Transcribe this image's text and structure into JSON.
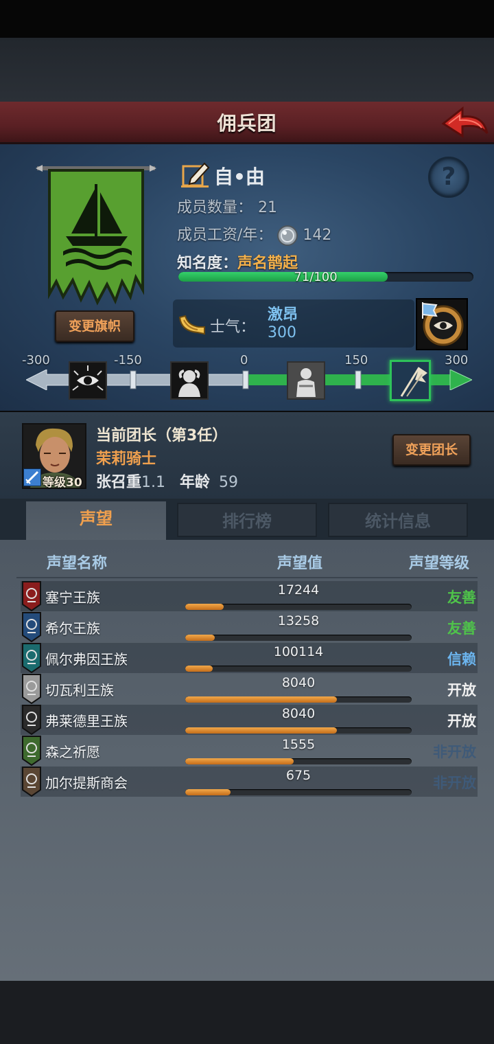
{
  "header": {
    "title": "佣兵团"
  },
  "guild": {
    "name": "自•由",
    "members_label": "成员数量：",
    "members_value": "21",
    "salary_label": "成员工资/年：",
    "salary_value": "142",
    "fame_label": "知名度：",
    "fame_value": "声名鹊起",
    "fame_progress_text": "71/100",
    "fame_progress": 0.71,
    "change_banner_label": "变更旗帜",
    "help_glyph": "?"
  },
  "morale": {
    "label": "士气：",
    "state": "激昂",
    "value": "300",
    "scale_labels": [
      "-300",
      "-150",
      "0",
      "150",
      "300"
    ],
    "level": 1.0
  },
  "leader": {
    "title": "当前团长（第3任）",
    "rank": "茉莉骑士",
    "name": "张召重",
    "name_suffix": "1.1",
    "age_label": "年龄",
    "age_value": "59",
    "level_text": "等级30",
    "change_leader_label": "变更团长"
  },
  "tabs": [
    {
      "label": "声望",
      "active": true
    },
    {
      "label": "排行榜",
      "active": false
    },
    {
      "label": "统计信息",
      "active": false
    }
  ],
  "table": {
    "headers": {
      "name": "声望名称",
      "value": "声望值",
      "level": "声望等级"
    },
    "rows": [
      {
        "name": "塞宁王族",
        "value": "17244",
        "fill": 0.17,
        "level": "友善",
        "level_color": "#4fc44a",
        "icon_color": "#8a1d1d"
      },
      {
        "name": "希尔王族",
        "value": "13258",
        "fill": 0.13,
        "level": "友善",
        "level_color": "#4fc44a",
        "icon_color": "#244b7a"
      },
      {
        "name": "佩尔弗因王族",
        "value": "100114",
        "fill": 0.12,
        "level": "信赖",
        "level_color": "#6cb6f0",
        "icon_color": "#1b6b6e"
      },
      {
        "name": "切瓦利王族",
        "value": "8040",
        "fill": 0.67,
        "level": "开放",
        "level_color": "#f0f0f0",
        "icon_color": "#9a9a9a"
      },
      {
        "name": "弗莱德里王族",
        "value": "8040",
        "fill": 0.67,
        "level": "开放",
        "level_color": "#f0f0f0",
        "icon_color": "#2b2b2b"
      },
      {
        "name": "森之祈愿",
        "value": "1555",
        "fill": 0.48,
        "level": "非开放",
        "level_color": "#3f5a78",
        "icon_color": "#3e6a2e"
      },
      {
        "name": "加尔提斯商会",
        "value": "675",
        "fill": 0.2,
        "level": "非开放",
        "level_color": "#3f5a78",
        "icon_color": "#5a4634"
      }
    ]
  },
  "colors": {
    "accent_orange": "#f0a04e",
    "bar_green": "#2ec25a",
    "header_red": "#6e2a2d"
  },
  "icons": [
    "back-arrow-icon",
    "pencil-icon",
    "help-icon",
    "silver-coin-icon",
    "horn-icon",
    "morale-badge-icon",
    "sword-icon"
  ]
}
